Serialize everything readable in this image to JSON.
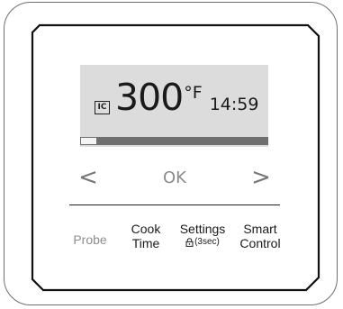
{
  "display": {
    "mode_icon_label": "IC",
    "temperature": "300",
    "unit": "°F",
    "clock": "14:59",
    "progress_fraction": 0.08
  },
  "nav": {
    "left_icon": "chevron-left-icon",
    "left_glyph": "<",
    "ok_label": "OK",
    "right_icon": "chevron-right-icon",
    "right_glyph": ">"
  },
  "functions": [
    {
      "line1": "Probe",
      "line2": ""
    },
    {
      "line1": "Cook",
      "line2": "Time"
    },
    {
      "line1": "Settings",
      "line2": "(3sec)"
    },
    {
      "line1": "Smart",
      "line2": "Control"
    }
  ],
  "colors": {
    "display_background": "#dcdcdc",
    "progress_track": "#6f6f6f",
    "progress_fill": "#f4f4f4",
    "dim_label": "#8d8d8d"
  }
}
